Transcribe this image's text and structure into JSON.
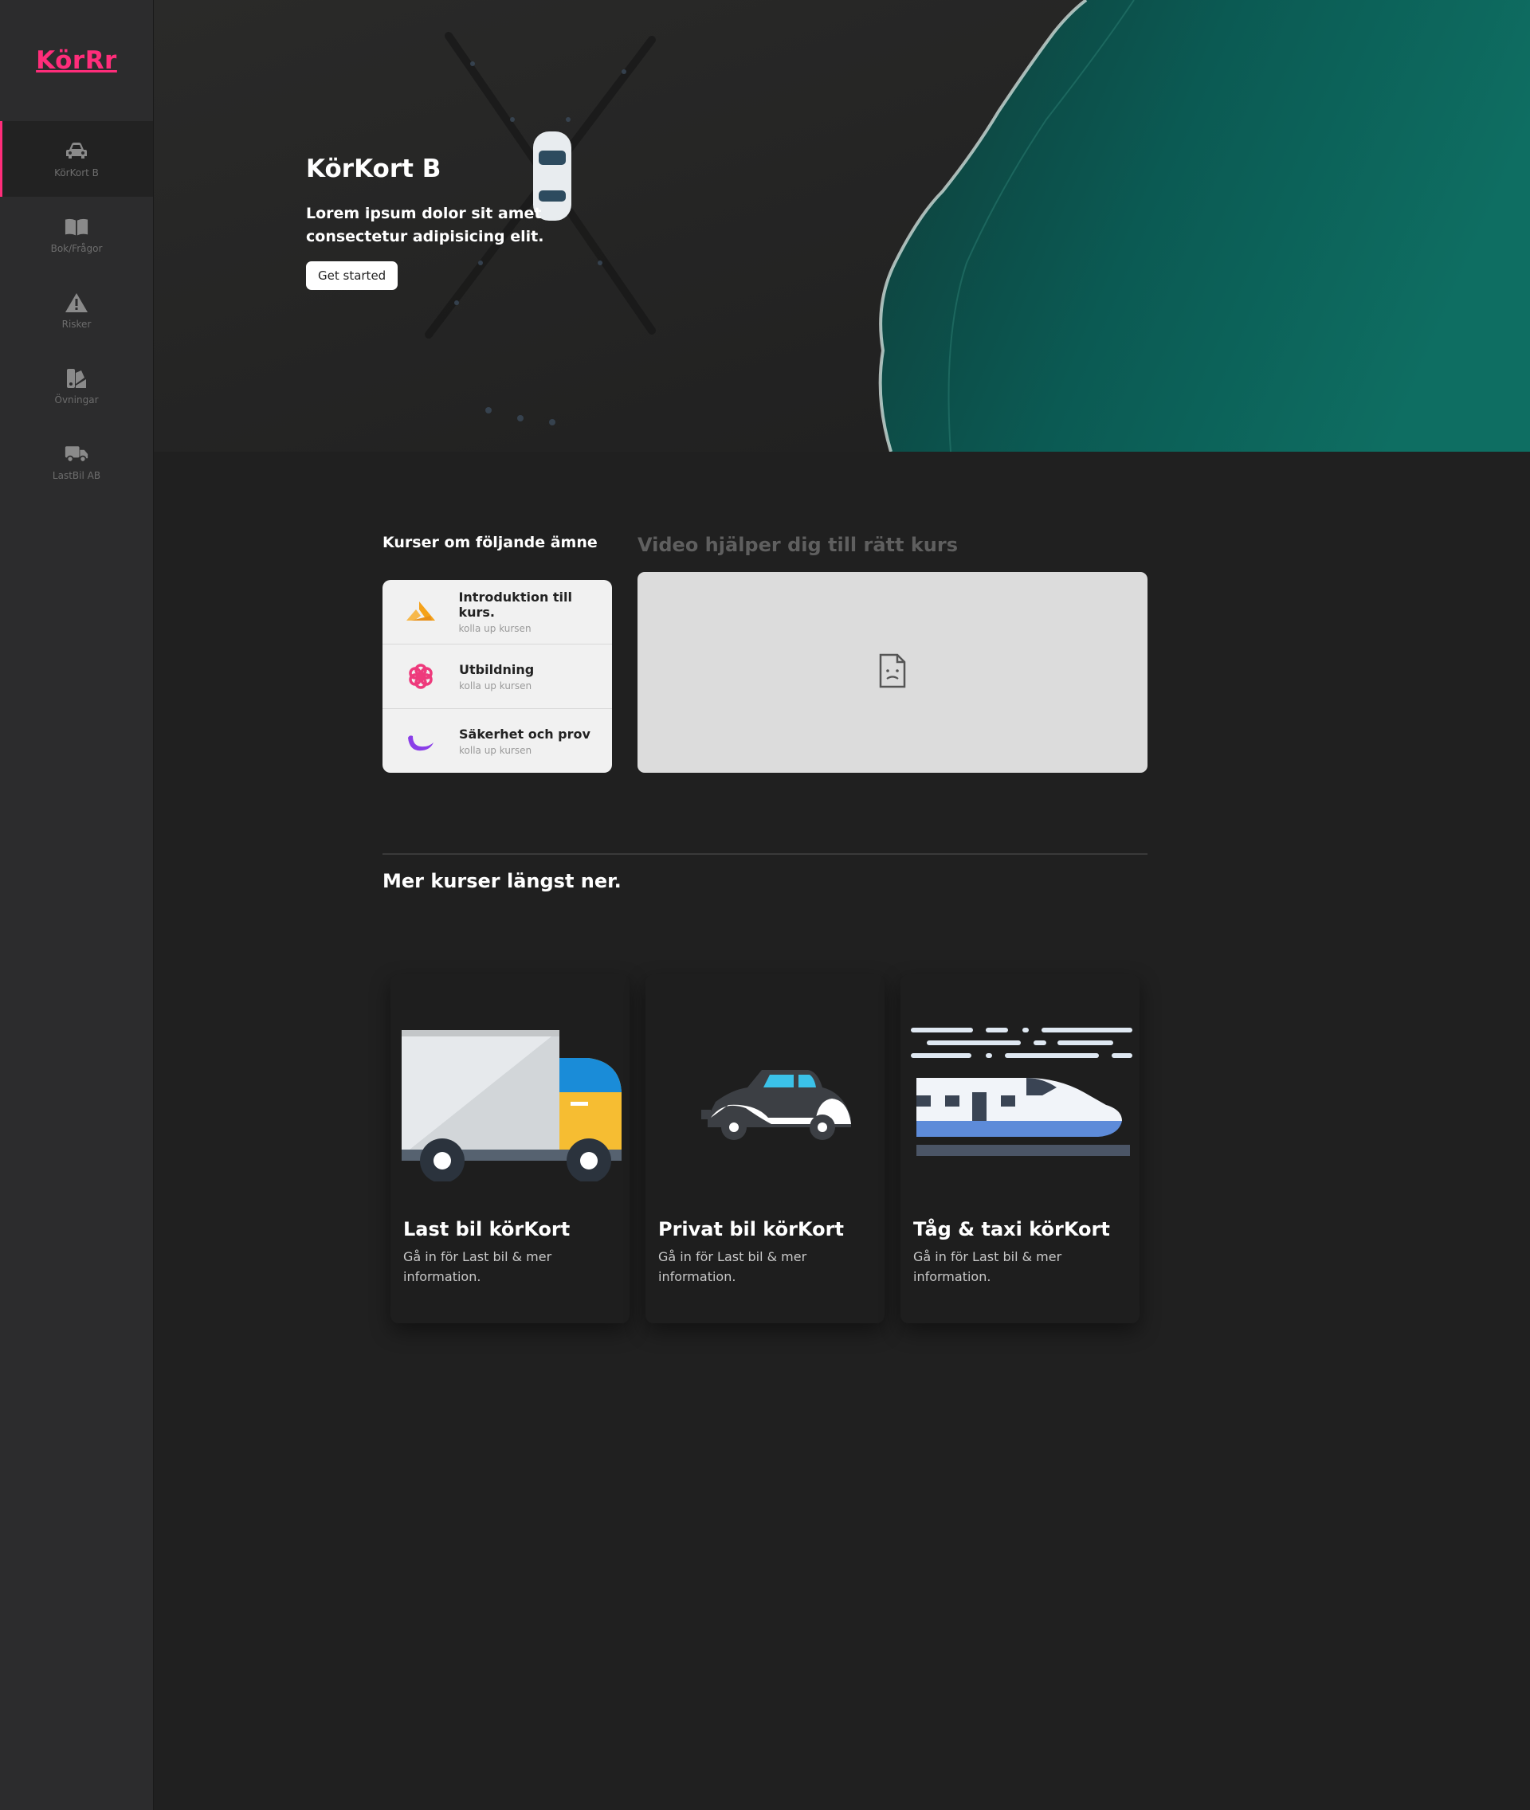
{
  "brand": {
    "logo": "KörRr",
    "accent": "#ff2d7a"
  },
  "sidebar": {
    "items": [
      {
        "label": "KörKort B",
        "icon": "car-icon",
        "active": true
      },
      {
        "label": "Bok/Frågor",
        "icon": "book-icon",
        "active": false
      },
      {
        "label": "Risker",
        "icon": "warning-icon",
        "active": false
      },
      {
        "label": "Övningar",
        "icon": "exercise-icon",
        "active": false
      },
      {
        "label": "LastBil AB",
        "icon": "truck-icon",
        "active": false
      }
    ]
  },
  "hero": {
    "title": "KörKort B",
    "text": "Lorem ipsum dolor sit amet consectetur adipisicing elit.",
    "button": "Get started"
  },
  "topics": {
    "heading": "Kurser om följande ämne",
    "items": [
      {
        "title": "Introduktion till kurs.",
        "subtitle": "kolla up kursen",
        "icon": "intro-icon",
        "color": "#f5a21a"
      },
      {
        "title": "Utbildning",
        "subtitle": "kolla up kursen",
        "icon": "flower-icon",
        "color": "#ee3a7c"
      },
      {
        "title": "Säkerhet och prov",
        "subtitle": "kolla up kursen",
        "icon": "crescent-icon",
        "color": "#8a3ee8"
      }
    ]
  },
  "video": {
    "heading": "Video hjälper dig till rätt kurs",
    "icon": "broken-file-icon"
  },
  "more": {
    "heading": "Mer kurser längst ner.",
    "cards": [
      {
        "title": "Last bil körKort",
        "text": "Gå in för Last bil & mer information.",
        "image": "truck-illustration"
      },
      {
        "title": "Privat bil körKort",
        "text": "Gå in för Last bil & mer information.",
        "image": "car-illustration"
      },
      {
        "title": "Tåg & taxi körKort",
        "text": "Gå in för Last bil & mer information.",
        "image": "train-illustration"
      }
    ]
  }
}
